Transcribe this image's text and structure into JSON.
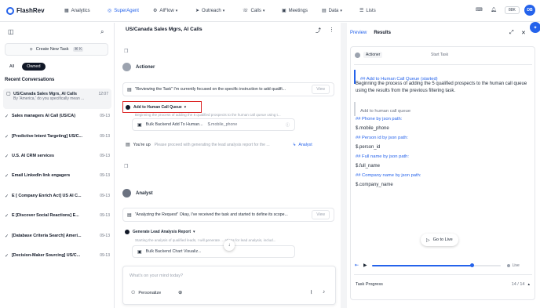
{
  "nav": {
    "logo": "FlashRev",
    "items": [
      "Analytics",
      "SuperAgent",
      "AIFlow",
      "Outreach",
      "Calls",
      "Meetings",
      "Data",
      "Lists"
    ],
    "credit": "88K",
    "avatar": "DB",
    "accent": "#2563eb"
  },
  "sidebar": {
    "create_label": "Create New Task",
    "shortcut": "⌘ K",
    "tabs": [
      "All",
      "Owned"
    ],
    "section": "Recent Conversations",
    "conversations": [
      {
        "title": "US/Canada Sales Mgrs, AI Calls",
        "date": "12:07",
        "preview": "By 'America,' do you specifically mean ..."
      },
      {
        "title": "Sales managers AI Call (US/CA)",
        "date": "09-13"
      },
      {
        "title": "[Predictive Intent Targeting] US/C...",
        "date": "09-13"
      },
      {
        "title": "U.S. AI CRM services",
        "date": "09-13"
      },
      {
        "title": "Email LinkedIn link engagers",
        "date": "09-13"
      },
      {
        "title": "E [ Company Enrich Act] US AI C...",
        "date": "09-13"
      },
      {
        "title": "E [Discover Social Reactions] E...",
        "date": "09-13"
      },
      {
        "title": "[Database Criteria Search] Ameri...",
        "date": "09-13"
      },
      {
        "title": "[Decision-Maker Sourcing] US/C...",
        "date": "09-13"
      }
    ]
  },
  "chat": {
    "title": "US/Canada Sales Mgrs, AI Calls",
    "actioner": {
      "name": "Actioner",
      "msg": "\"Reviewing the Task\" I'm currently focused on the specific instruction to add qualifi...",
      "view": "View",
      "task": "Add to Human Call Queue",
      "task_desc": "Beginning the process of adding the 5 qualified prospects to the human call queue using t...",
      "tool": "Bulk Backend Add To Human...",
      "tool_arg": "$.mobile_phone",
      "youre_up": "You're up",
      "youre_up_msg": "Please proceed with generating the lead analysis report for the ...",
      "assignee": "Analyst"
    },
    "analyst": {
      "name": "Analyst",
      "msg": "\"Analyzing the Request\" Okay, I've received the task and started to define its scope...",
      "view": "View",
      "task": "Generate Lead Analysis Report",
      "task_desc": "Starting the analysis of qualified leads, I will generate ... ations for lead analysis, includ...",
      "tool": "Bulk Backend Chart Visualiz..."
    },
    "input_placeholder": "What's on your mind today?",
    "personalize": "Personalize"
  },
  "right": {
    "tabs": [
      "Preview",
      "Results"
    ],
    "agent": "Actioner",
    "start_task": "Start Task",
    "heading": "## Add to Human Call Queue (started)",
    "para": "Beginning the process of adding the 5 qualified prospects to the human call queue using the results from the previous filtering task.",
    "sub": "Add to human call queue",
    "lines": [
      "## Phone by json path:",
      "$.mobile_phone",
      "## Person id by json path:",
      "$.person_id",
      "## Full name by json path:",
      "$.full_name",
      "## Company name by json path:",
      "$.company_name"
    ],
    "goto": "Go to Live",
    "live": "Live",
    "progress_label": "Task Progress",
    "progress_count": "14 / 14",
    "playback_fraction": 0.78
  }
}
